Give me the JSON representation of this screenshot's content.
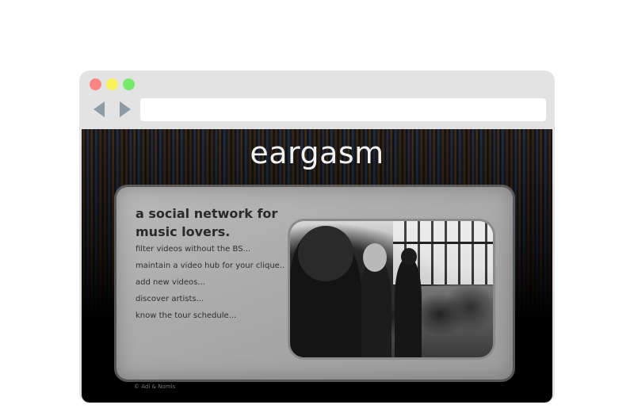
{
  "browser": {
    "url": ""
  },
  "site": {
    "title": "eargasm",
    "headline": "a social network for music lovers.",
    "features": [
      "filter videos without the BS...",
      "maintain a video hub for your clique..",
      "add new videos...",
      "discover artists...",
      "know the tour schedule..."
    ],
    "footer": "© Adi & Nomis"
  },
  "icons": {
    "back": "left-arrow-icon",
    "forward": "right-arrow-icon"
  },
  "colors": {
    "close_dot": "#fb8585",
    "minimize_dot": "#f8f25b",
    "maximize_dot": "#76ea6b",
    "nav_arrow": "#8e9aa4"
  }
}
